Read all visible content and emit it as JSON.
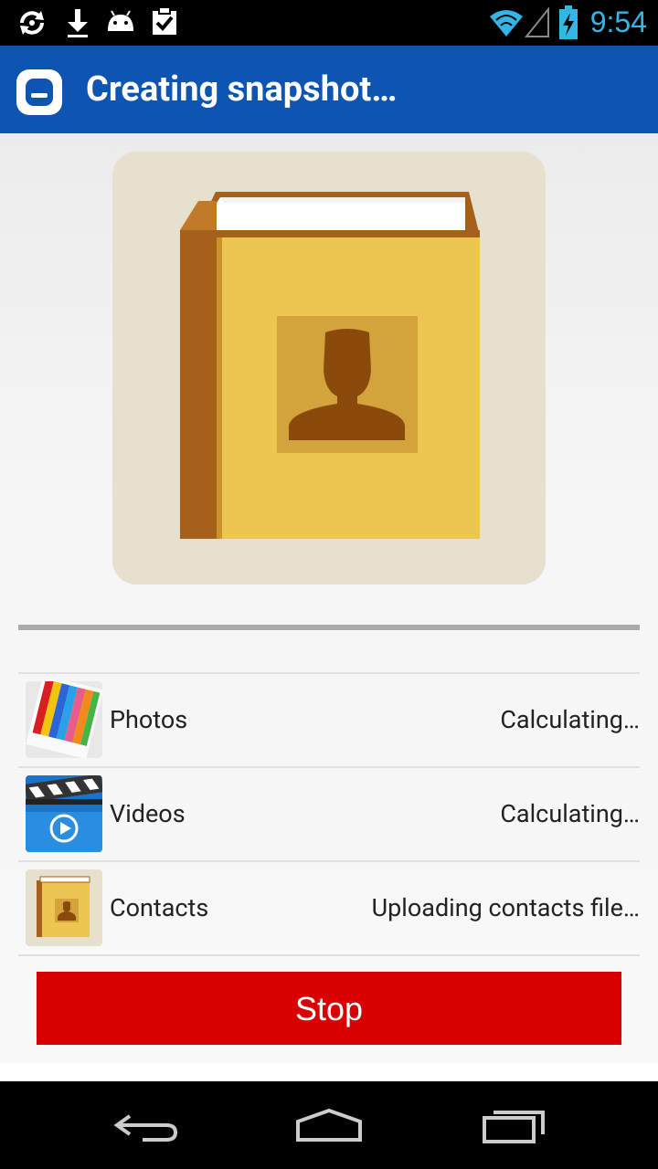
{
  "status_bar": {
    "time": "9:54",
    "icons": [
      "sync-icon",
      "download-icon",
      "android-icon",
      "clipboard-check-icon",
      "wifi-icon",
      "signal-icon",
      "battery-charging-icon"
    ]
  },
  "action_bar": {
    "title": "Creating snapshot…",
    "logo_icon": "app-logo-icon"
  },
  "hero": {
    "icon": "contacts-book-icon"
  },
  "progress": {
    "value": 0
  },
  "items": [
    {
      "label": "Photos",
      "status": "Calculating…",
      "icon": "photos-icon"
    },
    {
      "label": "Videos",
      "status": "Calculating…",
      "icon": "videos-icon"
    },
    {
      "label": "Contacts",
      "status": "Uploading contacts file…",
      "icon": "contacts-icon"
    }
  ],
  "stop_label": "Stop",
  "nav_bar": {
    "icons": [
      "back-icon",
      "home-icon",
      "recents-icon"
    ]
  },
  "colors": {
    "action_bar": "#0d55b0",
    "stop_button": "#d80000",
    "clock": "#33b5e5",
    "book_cover": "#ecc650",
    "book_spine": "#a5611a"
  }
}
